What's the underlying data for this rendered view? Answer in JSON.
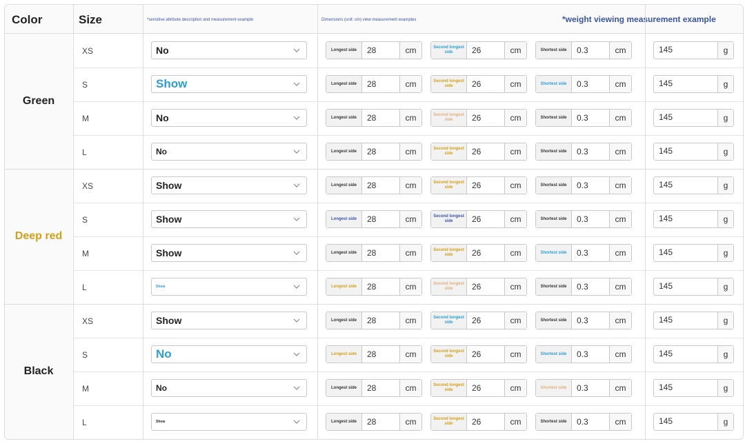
{
  "header": {
    "color": "Color",
    "size": "Size",
    "attr_desc": "*sensitive attribute description and measurement example",
    "dims_desc": "Dimensions (unit: cm) view measurement examples",
    "weight_desc": "*weight viewing measurement example"
  },
  "units": {
    "length": "cm",
    "weight": "g"
  },
  "groups": [
    {
      "color": "Green",
      "text_color": "#222222"
    },
    {
      "color": "Deep red",
      "text_color": "#d4a017"
    },
    {
      "color": "Black",
      "text_color": "#222222"
    }
  ],
  "rows": [
    {
      "size": "XS",
      "select": "No",
      "select_color": "#222222",
      "select_size": "normal",
      "l_label": "Longest side",
      "l_val": "28",
      "s_label": "Second longest side",
      "s_val": "26",
      "t_label": "Shortest side",
      "t_val": "0.3",
      "weight": "145"
    },
    {
      "size": "S",
      "select": "Show",
      "select_color": "#2a9fd8",
      "select_size": "large",
      "l_label": "Longest side",
      "l_val": "28",
      "s_label": "Second longest side",
      "s_val": "26",
      "t_label": "Shortest side",
      "t_val": "0.3",
      "weight": "145"
    },
    {
      "size": "M",
      "select": "No",
      "select_color": "#222222",
      "select_size": "normal",
      "l_label": "Longest side",
      "l_val": "28",
      "s_label": "Second longest side",
      "s_val": "26",
      "t_label": "Shortest side",
      "t_val": "0.3",
      "weight": "145"
    },
    {
      "size": "L",
      "select": "No",
      "select_color": "#222222",
      "select_size": "small",
      "l_label": "Longest side",
      "l_val": "28",
      "s_label": "Second longest side",
      "s_val": "26",
      "t_label": "Shortest side",
      "t_val": "0.3",
      "weight": "145"
    },
    {
      "size": "XS",
      "select": "Show",
      "select_color": "#222222",
      "select_size": "normal",
      "l_label": "Longest side",
      "l_val": "28",
      "s_label": "Second longest side",
      "s_val": "26",
      "t_label": "Shortest side",
      "t_val": "0.3",
      "weight": "145"
    },
    {
      "size": "S",
      "select": "Show",
      "select_color": "#222222",
      "select_size": "normal",
      "l_label": "Longest side",
      "l_val": "28",
      "s_label": "Second longest side",
      "s_val": "26",
      "t_label": "Shortest side",
      "t_val": "0.3",
      "weight": "145"
    },
    {
      "size": "M",
      "select": "Show",
      "select_color": "#222222",
      "select_size": "normal",
      "l_label": "Longest side",
      "l_val": "28",
      "s_label": "Second longest side",
      "s_val": "26",
      "t_label": "Shortest side",
      "t_val": "0.3",
      "weight": "145"
    },
    {
      "size": "L",
      "select": "Show",
      "select_color": "#2a9fd8",
      "select_size": "tiny",
      "l_label": "Longest side",
      "l_val": "28",
      "s_label": "Second longest side",
      "s_val": "26",
      "t_label": "Shortest side",
      "t_val": "0.3",
      "weight": "145"
    },
    {
      "size": "XS",
      "select": "Show",
      "select_color": "#222222",
      "select_size": "normal",
      "l_label": "Longest side",
      "l_val": "28",
      "s_label": "Second longest side",
      "s_val": "26",
      "t_label": "Shortest side",
      "t_val": "0.3",
      "weight": "145"
    },
    {
      "size": "S",
      "select": "No",
      "select_color": "#2a9fd8",
      "select_size": "large",
      "l_label": "Longest side",
      "l_val": "28",
      "s_label": "Second longest side",
      "s_val": "26",
      "t_label": "Shortest side",
      "t_val": "0.3",
      "weight": "145"
    },
    {
      "size": "M",
      "select": "No",
      "select_color": "#222222",
      "select_size": "small",
      "l_label": "Longest side",
      "l_val": "28",
      "s_label": "Second longest side",
      "s_val": "26",
      "t_label": "Shortest side",
      "t_val": "0.3",
      "weight": "145"
    },
    {
      "size": "L",
      "select": "Show",
      "select_color": "#222222",
      "select_size": "tiny",
      "l_label": "Longest side",
      "l_val": "28",
      "s_label": "Second longest side",
      "s_val": "26",
      "t_label": "Shortest side",
      "t_val": "0.3",
      "weight": "145"
    }
  ],
  "label_colors": {
    "l": [
      "#333333",
      "#333333",
      "#333333",
      "#333333",
      "#333333",
      "#3b55a8",
      "#333333",
      "#d4a017",
      "#333333",
      "#d4a017",
      "#333333",
      "#333333"
    ],
    "s": [
      "#2a9fd8",
      "#d4a017",
      "#e0b080",
      "#d4a017",
      "#d4a017",
      "#3b55a8",
      "#d4a017",
      "#e0b080",
      "#2a9fd8",
      "#d4a017",
      "#d4a017",
      "#d4a017"
    ],
    "t": [
      "#333333",
      "#2a9fd8",
      "#333333",
      "#333333",
      "#333333",
      "#333333",
      "#2a9fd8",
      "#333333",
      "#333333",
      "#2a9fd8",
      "#e0b080",
      "#333333"
    ]
  },
  "icons": {
    "dropdown": "chevron-down-icon"
  }
}
